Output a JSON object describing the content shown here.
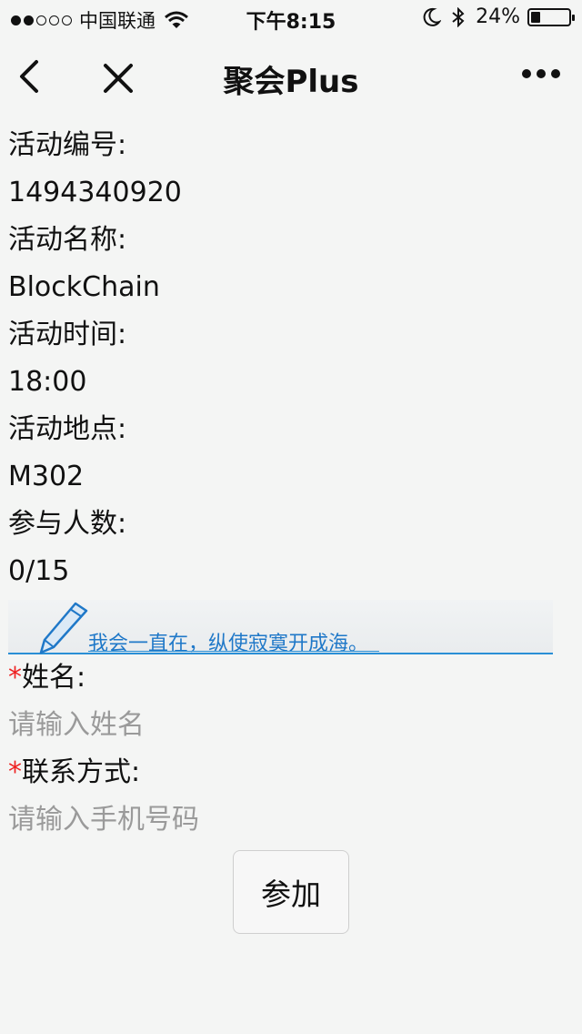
{
  "status_bar": {
    "carrier": "中国联通",
    "time": "下午8:15",
    "battery_percent": "24%",
    "battery_level": 0.24,
    "signal_dots_filled": 2,
    "signal_dots_total": 5
  },
  "nav": {
    "title": "聚会Plus",
    "icons": [
      "back-arrow-icon",
      "close-icon",
      "more-dots-icon"
    ]
  },
  "activity": {
    "id_label": "活动编号:",
    "id_value": "1494340920",
    "name_label": "活动名称:",
    "name_value": "BlockChain",
    "time_label": "活动时间:",
    "time_value": "18:00",
    "place_label": "活动地点:",
    "place_value": "M302",
    "count_label": "参与人数:",
    "count_value": "0/15"
  },
  "banner": {
    "text": "我会一直在，纵使寂寞开成海。"
  },
  "form": {
    "required_mark": "*",
    "name_label": "姓名:",
    "name_placeholder": "请输入姓名",
    "contact_label": "联系方式:",
    "contact_placeholder": "请输入手机号码",
    "submit_label": "参加"
  },
  "colors": {
    "background": "#f4f5f4",
    "required": "#ee2222",
    "banner_text": "#1f78c8",
    "placeholder": "#9a9a9a"
  }
}
